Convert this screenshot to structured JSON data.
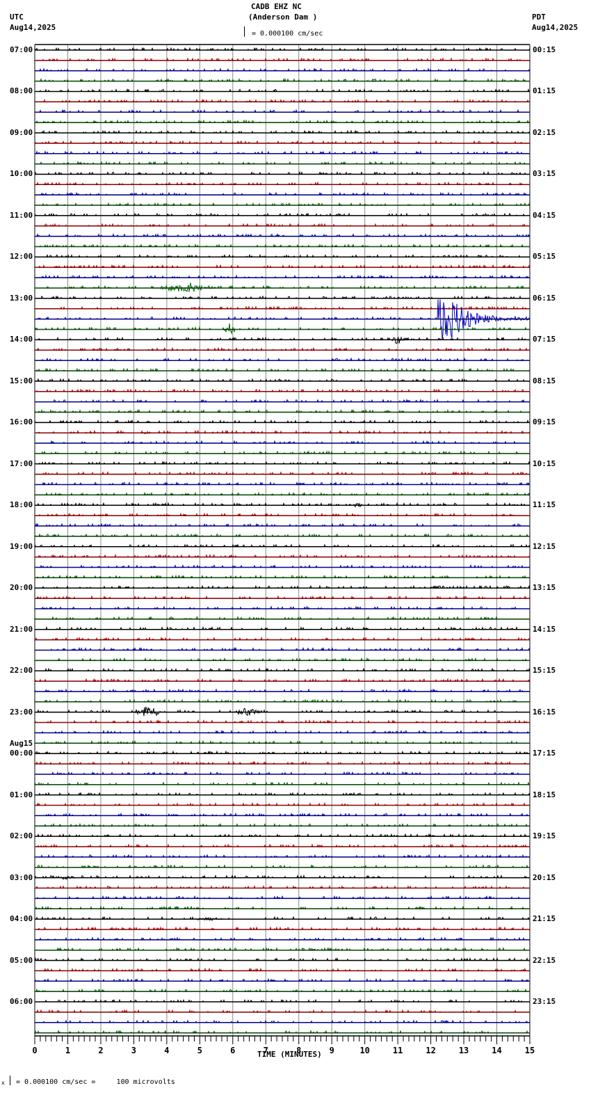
{
  "header": {
    "station": "CADB EHZ NC",
    "location": "(Anderson Dam )",
    "scale": "= 0.000100 cm/sec",
    "left_tz": "UTC",
    "left_date": "Aug14,2025",
    "right_tz": "PDT",
    "right_date": "Aug14,2025"
  },
  "footer": {
    "scale_note": "= 0.000100 cm/sec =     100 microvolts",
    "mark": "x"
  },
  "chart_data": {
    "type": "line",
    "title": "CADB EHZ NC (Anderson Dam )",
    "xlabel": "TIME (MINUTES)",
    "xlim": [
      0,
      15
    ],
    "x_ticks": [
      "0",
      "1",
      "2",
      "3",
      "4",
      "5",
      "6",
      "7",
      "8",
      "9",
      "10",
      "11",
      "12",
      "13",
      "14",
      "15"
    ],
    "minor_tick_seconds": 10,
    "trace_minutes": 15,
    "trace_count": 96,
    "trace_colors": [
      "#000000",
      "#cc0000",
      "#0000cc",
      "#006600"
    ],
    "left_labels": [
      {
        "trace": 0,
        "text": "07:00"
      },
      {
        "trace": 4,
        "text": "08:00"
      },
      {
        "trace": 8,
        "text": "09:00"
      },
      {
        "trace": 12,
        "text": "10:00"
      },
      {
        "trace": 16,
        "text": "11:00"
      },
      {
        "trace": 20,
        "text": "12:00"
      },
      {
        "trace": 24,
        "text": "13:00"
      },
      {
        "trace": 28,
        "text": "14:00"
      },
      {
        "trace": 32,
        "text": "15:00"
      },
      {
        "trace": 36,
        "text": "16:00"
      },
      {
        "trace": 40,
        "text": "17:00"
      },
      {
        "trace": 44,
        "text": "18:00"
      },
      {
        "trace": 48,
        "text": "19:00"
      },
      {
        "trace": 52,
        "text": "20:00"
      },
      {
        "trace": 56,
        "text": "21:00"
      },
      {
        "trace": 60,
        "text": "22:00"
      },
      {
        "trace": 64,
        "text": "23:00"
      },
      {
        "trace": 68,
        "text": "00:00",
        "date": "Aug15"
      },
      {
        "trace": 72,
        "text": "01:00"
      },
      {
        "trace": 76,
        "text": "02:00"
      },
      {
        "trace": 80,
        "text": "03:00"
      },
      {
        "trace": 84,
        "text": "04:00"
      },
      {
        "trace": 88,
        "text": "05:00"
      },
      {
        "trace": 92,
        "text": "06:00"
      }
    ],
    "right_labels": [
      "00:15",
      "01:15",
      "02:15",
      "03:15",
      "04:15",
      "05:15",
      "06:15",
      "07:15",
      "08:15",
      "09:15",
      "10:15",
      "11:15",
      "12:15",
      "13:15",
      "14:15",
      "15:15",
      "16:15",
      "17:15",
      "18:15",
      "19:15",
      "20:15",
      "21:15",
      "22:15",
      "23:15"
    ],
    "events": [
      {
        "trace": 23,
        "start": 3.6,
        "end": 5.5,
        "amp": 6
      },
      {
        "trace": 25,
        "start": 7.1,
        "end": 7.2,
        "amp": 3
      },
      {
        "trace": 26,
        "start": 12.2,
        "end": 15,
        "amp": 30,
        "coda": true
      },
      {
        "trace": 27,
        "start": 5.7,
        "end": 6.1,
        "amp": 9
      },
      {
        "trace": 28,
        "start": 10.8,
        "end": 11.2,
        "amp": 6
      },
      {
        "trace": 37,
        "start": 3.2,
        "end": 3.6,
        "amp": 2
      },
      {
        "trace": 44,
        "start": 9.6,
        "end": 10.0,
        "amp": 3
      },
      {
        "trace": 64,
        "start": 3.0,
        "end": 3.9,
        "amp": 8
      },
      {
        "trace": 64,
        "start": 6.0,
        "end": 6.9,
        "amp": 6
      },
      {
        "trace": 80,
        "start": 0.7,
        "end": 1.3,
        "amp": 3
      },
      {
        "trace": 84,
        "start": 4.8,
        "end": 5.8,
        "amp": 2
      }
    ]
  }
}
